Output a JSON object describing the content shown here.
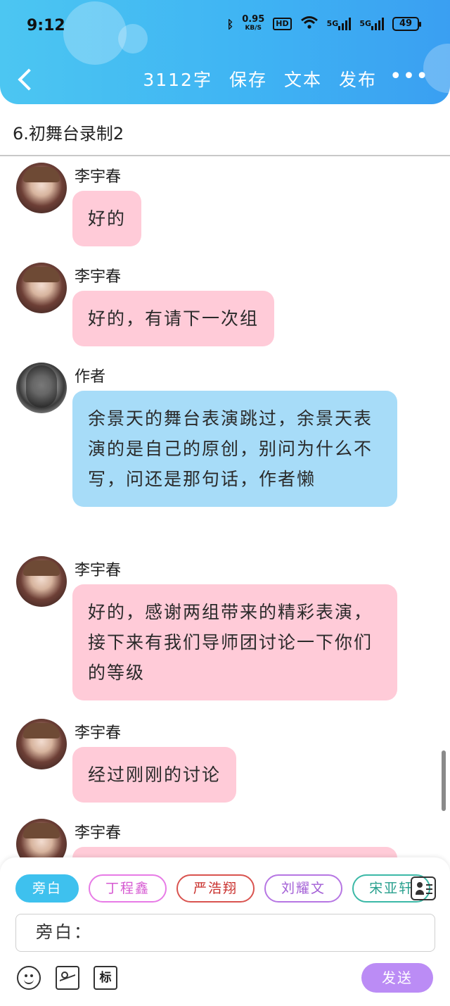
{
  "status_bar": {
    "time": "9:12",
    "net_speed_value": "0.95",
    "net_speed_unit": "KB/S",
    "hd_label": "HD",
    "sim1_label": "5G",
    "sim2_label": "5G",
    "battery": "49"
  },
  "nav": {
    "word_count": "3112字",
    "save": "保存",
    "text": "文本",
    "publish": "发布",
    "more": "•••"
  },
  "chapter": {
    "title": "6.初舞台录制2"
  },
  "messages": [
    {
      "sender": "李宇春",
      "text": "好的",
      "color": "pink"
    },
    {
      "sender": "李宇春",
      "text": "好的，有请下一次组",
      "color": "pink"
    },
    {
      "sender": "作者",
      "text": "余景天的舞台表演跳过，余景天表演的是自己的原创，别问为什么不写，问还是那句话，作者懒",
      "color": "blue"
    },
    {
      "sender": "李宇春",
      "text": "好的，感谢两组带来的精彩表演，接下来有我们导师团讨论一下你们的等级",
      "color": "pink"
    },
    {
      "sender": "李宇春",
      "text": "经过刚刚的讨论",
      "color": "pink"
    },
    {
      "sender": "李宇春",
      "text": "",
      "color": "pink"
    }
  ],
  "roles": [
    {
      "label": "旁白",
      "color": "#3ec1ee"
    },
    {
      "label": "丁程鑫",
      "color": "#e77be6"
    },
    {
      "label": "严浩翔",
      "color": "#d9534f"
    },
    {
      "label": "刘耀文",
      "color": "#b676e3"
    },
    {
      "label": "宋亚轩",
      "color": "#3cb9a7"
    }
  ],
  "input": {
    "value": "旁白："
  },
  "toolbar": {
    "mark_label": "标",
    "send_label": "发送"
  },
  "colors": {
    "header": "#3fb4f3",
    "pink_bubble": "#ffcbd8",
    "blue_bubble": "#a7dcf8",
    "send": "#bb8cf5"
  }
}
